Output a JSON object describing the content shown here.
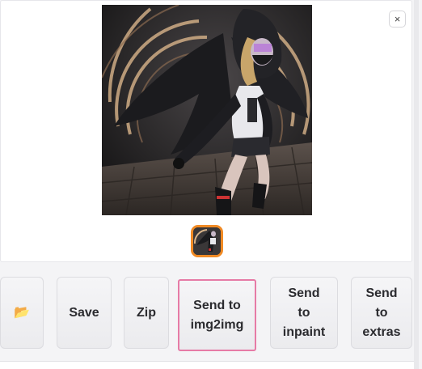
{
  "gallery": {
    "close_label": "×",
    "preview_alt": "generated image preview",
    "thumbnail_selected": true
  },
  "buttons": {
    "open_folder": "📂",
    "save": "Save",
    "zip": "Zip",
    "send_img2img": "Send to\nimg2img",
    "send_inpaint": "Send\nto\ninpaint",
    "send_extras": "Send\nto\nextras"
  },
  "colors": {
    "thumbnail_border": "#f08a24",
    "focused_button_border": "#e67ba6"
  }
}
